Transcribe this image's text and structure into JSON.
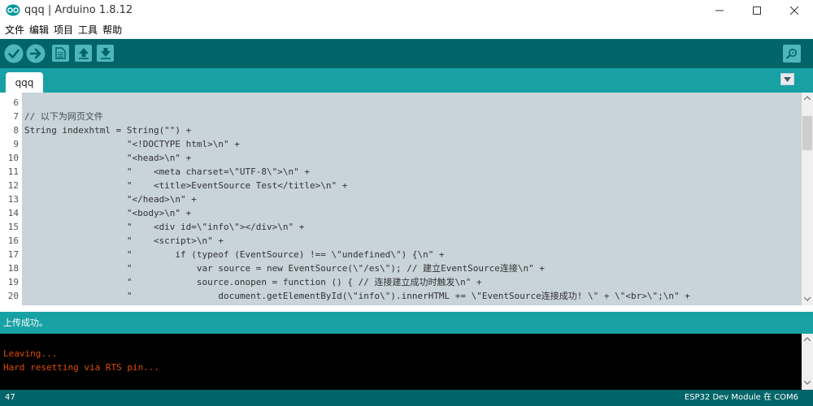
{
  "window": {
    "title": "qqq | Arduino 1.8.12"
  },
  "menu": [
    "文件",
    "编辑",
    "项目",
    "工具",
    "帮助"
  ],
  "toolbar": {
    "buttons": [
      "verify-icon",
      "upload-icon",
      "new-icon",
      "open-icon",
      "save-icon"
    ],
    "right_button": "serial-monitor-icon"
  },
  "tabs": [
    {
      "label": "qqq",
      "active": true
    }
  ],
  "editor": {
    "lines": [
      {
        "num": "6",
        "text": ""
      },
      {
        "num": "7",
        "text": "// 以下为网页文件"
      },
      {
        "num": "8",
        "text": "String indexhtml = String(\"\") +"
      },
      {
        "num": "9",
        "text": "                   \"<!DOCTYPE html>\\n\" +"
      },
      {
        "num": "10",
        "text": "                   \"<head>\\n\" +"
      },
      {
        "num": "11",
        "text": "                   \"    <meta charset=\\\"UTF-8\\\">\\n\" +"
      },
      {
        "num": "12",
        "text": "                   \"    <title>EventSource Test</title>\\n\" +"
      },
      {
        "num": "13",
        "text": "                   \"</head>\\n\" +"
      },
      {
        "num": "14",
        "text": "                   \"<body>\\n\" +"
      },
      {
        "num": "15",
        "text": "                   \"    <div id=\\\"info\\\"></div>\\n\" +"
      },
      {
        "num": "16",
        "text": "                   \"    <script>\\n\" +"
      },
      {
        "num": "17",
        "text": "                   \"        if (typeof (EventSource) !== \\\"undefined\\\") {\\n\" +"
      },
      {
        "num": "18",
        "text": "                   \"            var source = new EventSource(\\\"/es\\\"); // 建立EventSource连接\\n\" +"
      },
      {
        "num": "19",
        "text": "                   \"            source.onopen = function () { // 连接建立成功时触发\\n\" +"
      },
      {
        "num": "20",
        "text": "                   \"                document.getElementById(\\\"info\\\").innerHTML += \\\"EventSource连接成功! \\\" + \\\"<br>\\\";\\n\" +"
      }
    ]
  },
  "status": {
    "message": "上传成功。"
  },
  "console": {
    "lines": [
      "Leaving...",
      "Hard resetting via RTS pin..."
    ]
  },
  "footer": {
    "line_number": "47",
    "board": "ESP32 Dev Module 在 COM6"
  },
  "colors": {
    "toolbar": "#006468",
    "tabbar": "#17a1a5",
    "code_bg": "#c8d3da",
    "console_text": "#e34c00"
  }
}
